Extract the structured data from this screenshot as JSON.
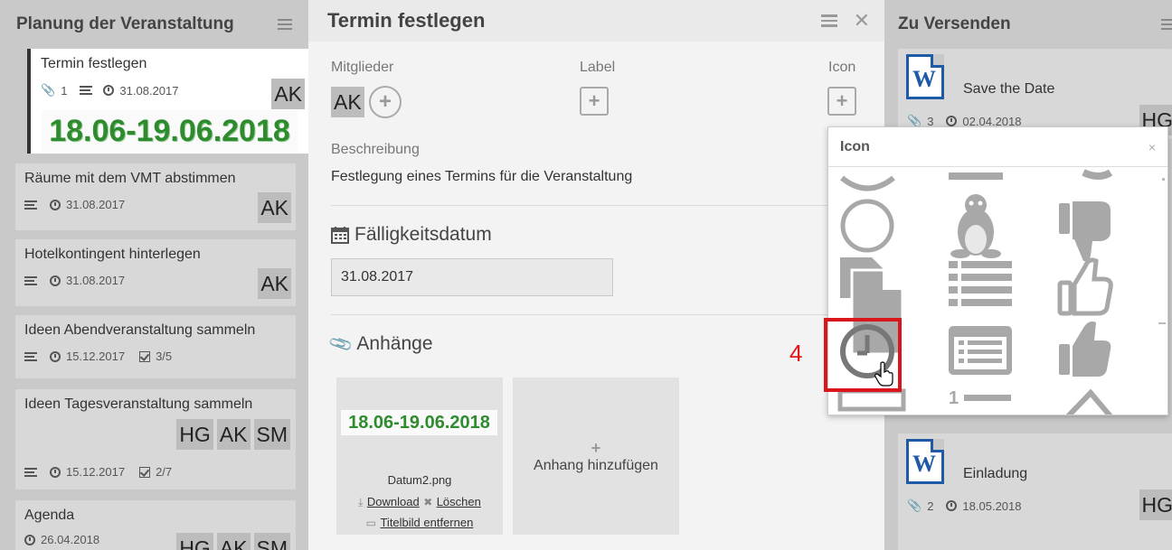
{
  "left_column": {
    "title": "Planung der Veranstaltung",
    "cards": [
      {
        "title": "Termin festlegen",
        "attachments": "1",
        "date": "31.08.2017",
        "members": [
          "AK"
        ],
        "cover_text": "18.06-19.06.2018"
      },
      {
        "title": "Räume mit dem VMT abstimmen",
        "date": "31.08.2017",
        "members": [
          "AK"
        ]
      },
      {
        "title": "Hotelkontingent hinterlegen",
        "date": "31.08.2017",
        "members": [
          "AK"
        ]
      },
      {
        "title": "Ideen Abendveranstaltung sammeln",
        "date": "15.12.2017",
        "checklist": "3/5"
      },
      {
        "title": "Ideen Tagesveranstaltung sammeln",
        "date": "15.12.2017",
        "checklist": "2/7",
        "members": [
          "HG",
          "AK",
          "SM"
        ]
      },
      {
        "title": "Agenda",
        "date": "26.04.2018",
        "members": [
          "HG",
          "AK",
          "SM"
        ]
      }
    ]
  },
  "modal": {
    "title": "Termin festlegen",
    "members_label": "Mitglieder",
    "member_initials": "AK",
    "label_label": "Label",
    "icon_label": "Icon",
    "description_label": "Beschreibung",
    "description_text": "Festlegung eines Termins für die Veranstaltung",
    "due_heading": "Fälligkeitsdatum",
    "due_value": "31.08.2017",
    "attachments_heading": "Anhänge",
    "attachment": {
      "preview_text": "18.06-19.06.2018",
      "filename": "Datum2.png",
      "download": "Download",
      "delete": "Löschen",
      "remove_cover": "Titelbild entfernen"
    },
    "add_attachment": "Anhang hinzufügen"
  },
  "right_column": {
    "title": "Zu Versenden",
    "cards": [
      {
        "title": "Save the Date",
        "attachments": "3",
        "date": "02.04.2018",
        "members": [
          "HG"
        ]
      },
      {
        "title": "Einladung",
        "attachments": "2",
        "date": "18.05.2018",
        "members": [
          "HG"
        ]
      }
    ]
  },
  "icon_popup": {
    "title": "Icon",
    "close": "×",
    "icons": [
      "circle-o-icon",
      "linux-icon",
      "thumbs-down-icon",
      "file-icon",
      "list-icon",
      "thumbs-o-up-icon",
      "clock-icon",
      "list-alt-icon",
      "thumbs-up-icon"
    ]
  },
  "annotation": {
    "step": "4",
    "color": "#d9161b"
  }
}
